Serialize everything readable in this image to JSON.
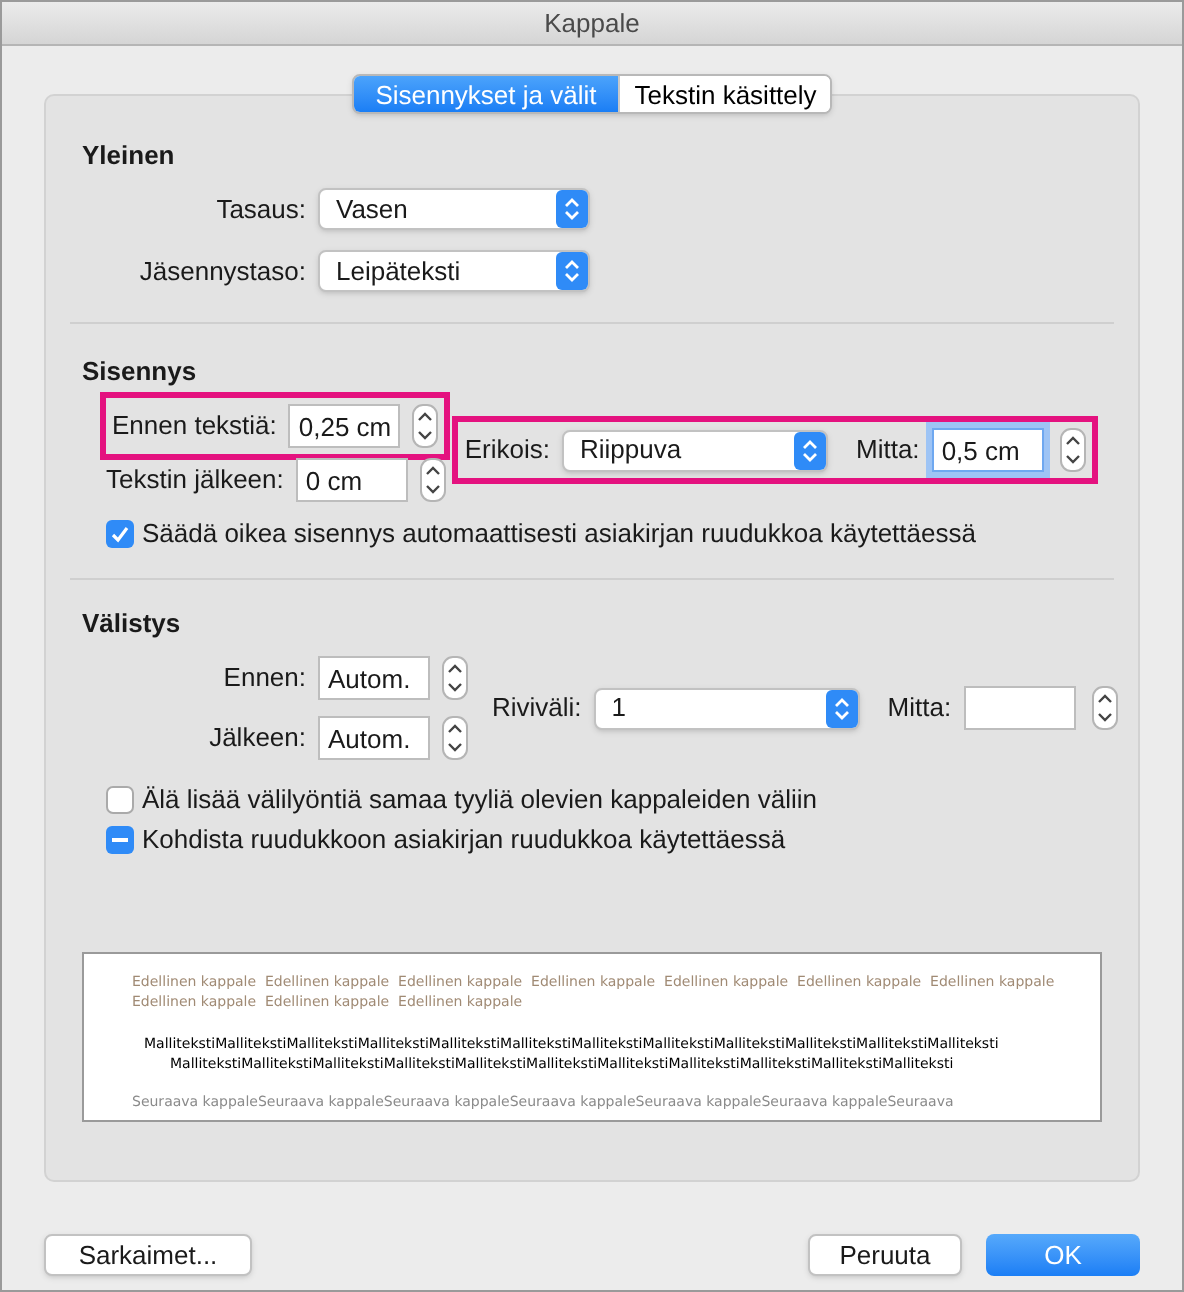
{
  "window": {
    "title": "Kappale"
  },
  "tabs": [
    {
      "label": "Sisennykset ja välit",
      "selected": true
    },
    {
      "label": "Tekstin käsittely",
      "selected": false
    }
  ],
  "general": {
    "heading": "Yleinen",
    "alignment": {
      "label": "Tasaus:",
      "value": "Vasen"
    },
    "outline_level": {
      "label": "Jäsennystaso:",
      "value": "Leipäteksti"
    }
  },
  "indentation": {
    "heading": "Sisennys",
    "before_text": {
      "label": "Ennen tekstiä:",
      "value": "0,25 cm",
      "highlighted": true
    },
    "after_text": {
      "label": "Tekstin jälkeen:",
      "value": "0 cm"
    },
    "special": {
      "label": "Erikois:",
      "value": "Riippuva",
      "highlighted": true
    },
    "by": {
      "label": "Mitta:",
      "value": "0,5 cm",
      "focused": true
    },
    "auto_adjust": {
      "label": "Säädä oikea sisennys automaattisesti asiakirjan ruudukkoa käytettäessä",
      "checked": true
    }
  },
  "spacing": {
    "heading": "Välistys",
    "before": {
      "label": "Ennen:",
      "value": "Autom."
    },
    "after": {
      "label": "Jälkeen:",
      "value": "Autom."
    },
    "line_spacing": {
      "label": "Riviväli:",
      "value": "1"
    },
    "at": {
      "label": "Mitta:"
    },
    "options": [
      {
        "label": "Älä lisää välilyöntiä samaa tyyliä olevien kappaleiden väliin",
        "checked": false,
        "indeterminate": false
      },
      {
        "label": "Kohdista ruudukkoon asiakirjan ruudukkoa käytettäessä",
        "indeterminate": true
      }
    ]
  },
  "preview": {
    "previous": [
      "Edellinen kappale  Edellinen kappale  Edellinen kappale  Edellinen kappale  Edellinen kappale  Edellinen kappale  Edellinen kappale",
      "Edellinen kappale  Edellinen kappale  Edellinen kappale"
    ],
    "sample": [
      "MallitekstiMallitekstiMallitekstiMallitekstiMallitekstiMallitekstiMallitekstiMallitekstiMallitekstiMallitekstiMallitekstiMalliteksti",
      "MallitekstiMallitekstiMallitekstiMallitekstiMallitekstiMallitekstiMallitekstiMallitekstiMallitekstiMallitekstiMalliteksti"
    ],
    "next": [
      "Seuraava kappaleSeuraava kappaleSeuraava kappaleSeuraava kappaleSeuraava kappaleSeuraava kappaleSeuraava"
    ]
  },
  "buttons": [
    {
      "label": "Sarkaimet...",
      "kind": "plain"
    },
    {
      "label": "Peruuta",
      "kind": "plain"
    },
    {
      "label": "OK",
      "kind": "default"
    }
  ]
}
